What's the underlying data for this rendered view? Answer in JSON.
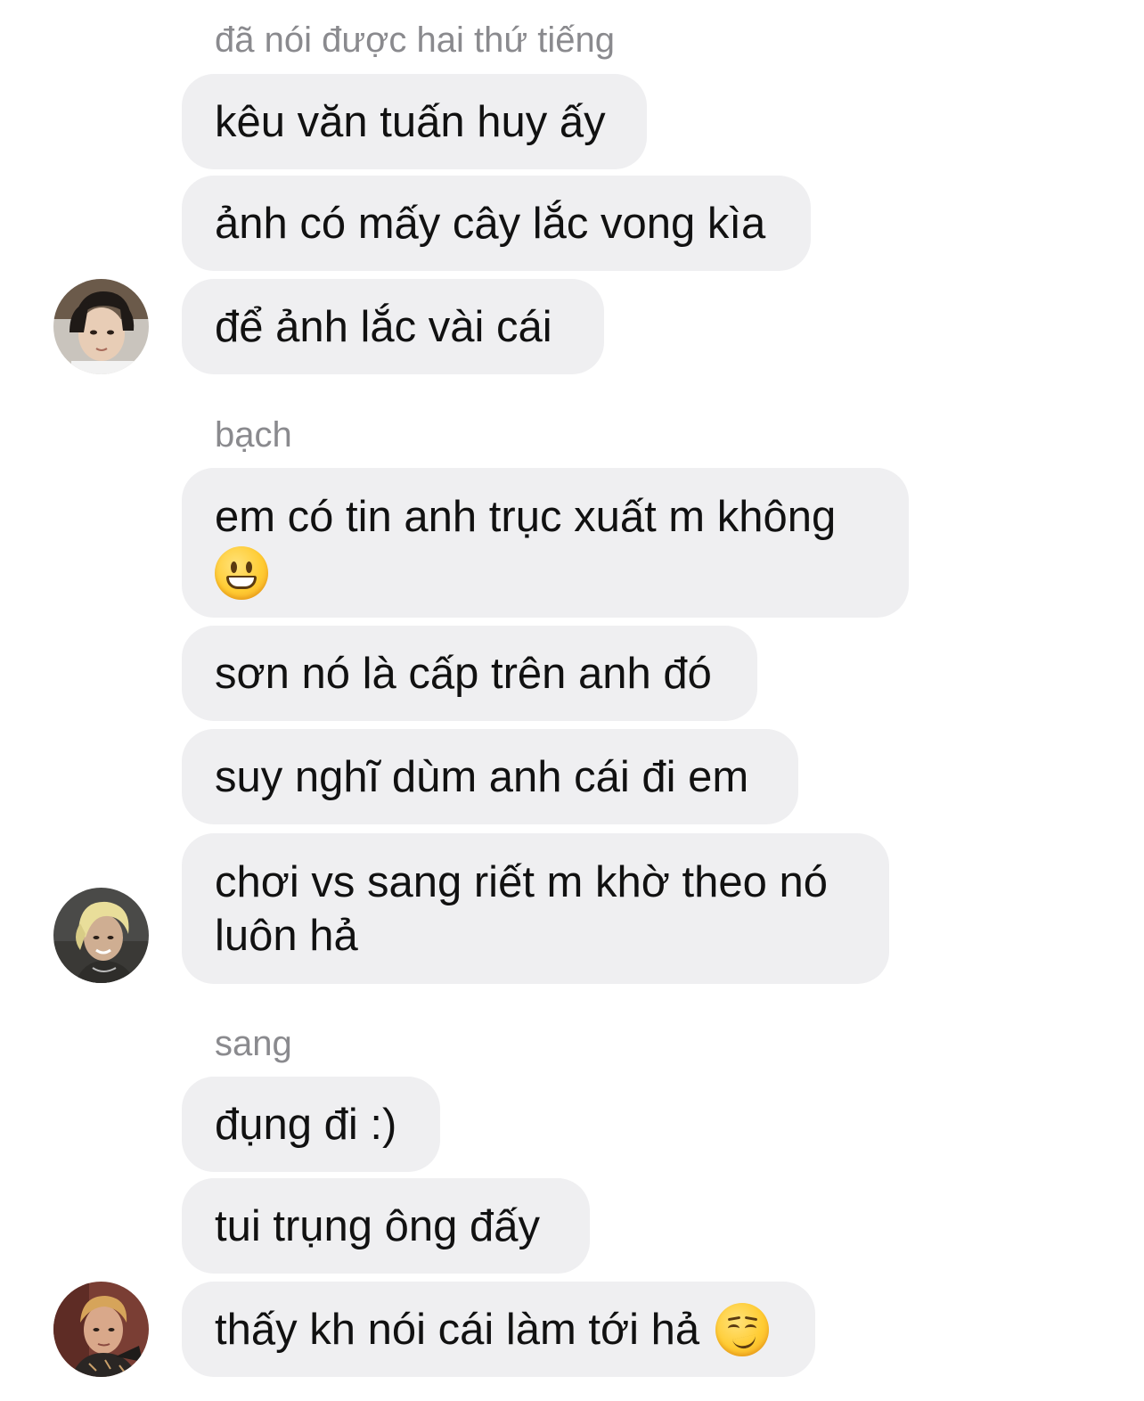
{
  "chat": {
    "groups": [
      {
        "sender": "đã nói được hai thứ tiếng",
        "messages": [
          "kêu văn tuấn huy ấy",
          "ảnh có mấy cây lắc vong kìa",
          "để ảnh lắc vài cái"
        ],
        "avatar_icon": "avatar-photo"
      },
      {
        "sender": "bạch",
        "messages": [
          "em có tin anh trục xuất m không",
          "sơn nó là cấp trên anh đó",
          "suy nghĩ dùm anh cái đi em",
          "chơi vs sang riết m khờ theo nó luôn hả"
        ],
        "emoji_icons": [
          "grinning-face-icon"
        ],
        "avatar_icon": "avatar-photo"
      },
      {
        "sender": "sang",
        "messages": [
          "đụng đi :)",
          "tui trụng ông đấy",
          "thấy kh nói cái làm tới hả"
        ],
        "emoji_icons": [
          "smirking-face-icon"
        ],
        "avatar_icon": "avatar-photo"
      }
    ]
  },
  "colors": {
    "bubble_bg": "#efeff1",
    "sender_name": "#8a8a8e",
    "message_text": "#111111",
    "background": "#ffffff"
  }
}
